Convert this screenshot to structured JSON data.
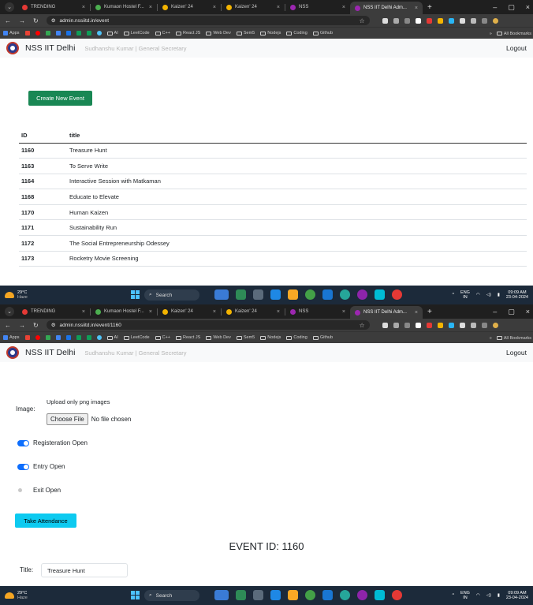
{
  "browser": {
    "tabs": [
      {
        "label": "TRENDING",
        "color": "#e53935"
      },
      {
        "label": "Kumaon Hostel F...",
        "color": "#4caf50"
      },
      {
        "label": "Kaizen' 24",
        "color": "#f4b400"
      },
      {
        "label": "Kaizen' 24",
        "color": "#f4b400"
      },
      {
        "label": "NSS",
        "color": "#9c27b0"
      },
      {
        "label": "NSS IIT Delhi Adm...",
        "color": "#9c27b0"
      }
    ],
    "new_tab": "+",
    "bookmarks": {
      "apps": "Apps",
      "folders": [
        "AI",
        "LeetCode",
        "C++",
        "React JS",
        "Web Dev",
        "Sem5",
        "Nodejs",
        "Coding",
        "Github"
      ],
      "overflow": "»",
      "all": "All Bookmarks"
    }
  },
  "shot1": {
    "url": "admin.nssiitd.in/event",
    "navbar": {
      "brand": "NSS IIT Delhi",
      "user": "Sudhanshu Kumar | General Secretary",
      "logout": "Logout"
    },
    "create_button": "Create New Event",
    "table": {
      "headers": [
        "ID",
        "title"
      ],
      "rows": [
        [
          "1160",
          "Treasure Hunt"
        ],
        [
          "1163",
          "To Serve Write"
        ],
        [
          "1164",
          "Interactive Session with Matkaman"
        ],
        [
          "1168",
          "Educate to Elevate"
        ],
        [
          "1170",
          "Human Kaizen"
        ],
        [
          "1171",
          "Sustainability Run"
        ],
        [
          "1172",
          "The Social Entrepreneurship Odessey"
        ],
        [
          "1173",
          "Rocketry Movie Screening"
        ]
      ]
    }
  },
  "shot2": {
    "url": "admin.nssiitd.in/event/1160",
    "navbar": {
      "brand": "NSS IIT Delhi",
      "user": "Sudhanshu Kumar | General Secretary",
      "logout": "Logout"
    },
    "image_label": "Image:",
    "image_hint": "Upload only png images",
    "file_button": "Choose File",
    "file_status": "No file chosen",
    "toggles": [
      {
        "label": "Registeration Open",
        "state": "on"
      },
      {
        "label": "Entry Open",
        "state": "on"
      },
      {
        "label": "Exit Open",
        "state": "off"
      }
    ],
    "attendance_button": "Take Attendance",
    "event_id_heading": "EVENT ID: 1160",
    "title_label": "Title:",
    "title_value": "Treasure Hunt"
  },
  "taskbar": {
    "temp": "29°C",
    "condition": "Haze",
    "search": "Search",
    "lang1": "ENG",
    "lang2": "IN",
    "time": "09:09 AM",
    "date": "23-04-2024"
  }
}
